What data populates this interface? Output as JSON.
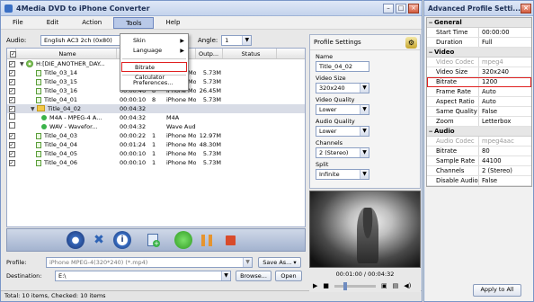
{
  "window": {
    "title": "4Media DVD to iPhone Converter"
  },
  "menubar": {
    "items": [
      "File",
      "Edit",
      "Action",
      "Tools",
      "Help"
    ]
  },
  "tools_menu": {
    "items": [
      {
        "label": "Skin",
        "submenu": true
      },
      {
        "label": "Language",
        "submenu": true
      },
      {
        "label": "Bitrate Calculator",
        "submenu": false
      },
      {
        "label": "Preferences...",
        "submenu": false
      }
    ]
  },
  "audio": {
    "label": "Audio:",
    "value": "English AC3 2ch (0x80)",
    "angle_label": "Angle:",
    "angle_value": "1"
  },
  "list": {
    "headers": [
      "Name",
      "Du",
      "",
      "Target",
      "Outp...",
      "Status"
    ],
    "rows": [
      {
        "kind": "disc",
        "checked": true,
        "name": "H:[DIE_ANOTHER_DAY...",
        "duration": "",
        "ch": "",
        "target": "",
        "output": "",
        "status": ""
      },
      {
        "kind": "title",
        "checked": true,
        "name": "Title_03_14",
        "duration": "00:00:10",
        "ch": "7",
        "target": "iPhone Mo...",
        "output": "5.73M",
        "status": ""
      },
      {
        "kind": "title",
        "checked": true,
        "name": "Title_03_15",
        "duration": "00:00:10",
        "ch": "7",
        "target": "iPhone Mo...",
        "output": "5.73M",
        "status": ""
      },
      {
        "kind": "title",
        "checked": true,
        "name": "Title_03_16",
        "duration": "00:00:46",
        "ch": "8",
        "target": "iPhone Mo...",
        "output": "26.45M",
        "status": ""
      },
      {
        "kind": "title",
        "checked": true,
        "name": "Title_04_01",
        "duration": "00:00:10",
        "ch": "8",
        "target": "iPhone Mo...",
        "output": "5.73M",
        "status": ""
      },
      {
        "kind": "folder",
        "checked": true,
        "name": "Title_04_02",
        "duration": "00:04:32",
        "ch": "",
        "target": "",
        "output": "",
        "status": ""
      },
      {
        "kind": "audio",
        "checked": false,
        "name": "M4A - MPEG-4 A...",
        "duration": "00:04:32",
        "ch": "",
        "target": "M4A",
        "output": "",
        "status": ""
      },
      {
        "kind": "audio",
        "checked": false,
        "name": "WAV - Wavefor...",
        "duration": "00:04:32",
        "ch": "",
        "target": "Wave Audio",
        "output": "",
        "status": ""
      },
      {
        "kind": "title",
        "checked": true,
        "name": "Title_04_03",
        "duration": "00:00:22",
        "ch": "1",
        "target": "iPhone Mo...",
        "output": "12.97M",
        "status": ""
      },
      {
        "kind": "title",
        "checked": true,
        "name": "Title_04_04",
        "duration": "00:01:24",
        "ch": "1",
        "target": "iPhone Mo...",
        "output": "48.30M",
        "status": ""
      },
      {
        "kind": "title",
        "checked": true,
        "name": "Title_04_05",
        "duration": "00:00:10",
        "ch": "1",
        "target": "iPhone Mo...",
        "output": "5.73M",
        "status": ""
      },
      {
        "kind": "title",
        "checked": true,
        "name": "Title_04_06",
        "duration": "00:00:10",
        "ch": "1",
        "target": "iPhone Mo...",
        "output": "5.73M",
        "status": ""
      }
    ]
  },
  "footer": {
    "profile_label": "Profile:",
    "profile_value": "iPhone MPEG-4(320*240)  (*.mp4)",
    "save_as": "Save As...",
    "destination_label": "Destination:",
    "destination_value": "E:\\",
    "browse": "Browse...",
    "open": "Open",
    "status": "Total: 10 items, Checked: 10 items"
  },
  "profile_settings": {
    "title": "Profile Settings",
    "fields": [
      {
        "label": "Name",
        "value": "Title_04_02",
        "type": "text"
      },
      {
        "label": "Video Size",
        "value": "320x240",
        "type": "select"
      },
      {
        "label": "Video Quality",
        "value": "Lower",
        "type": "select"
      },
      {
        "label": "Audio Quality",
        "value": "Lower",
        "type": "select"
      },
      {
        "label": "Channels",
        "value": "2 (Stereo)",
        "type": "select"
      },
      {
        "label": "Split",
        "value": "Infinite",
        "type": "select"
      }
    ]
  },
  "player": {
    "time": "00:01:00 / 00:04:32"
  },
  "advanced": {
    "title": "Advanced Profile Setti...",
    "apply": "Apply to All",
    "sections": [
      {
        "name": "General",
        "props": [
          {
            "k": "Start Time",
            "v": "00:00:00"
          },
          {
            "k": "Duration",
            "v": "Full"
          }
        ]
      },
      {
        "name": "Video",
        "props": [
          {
            "k": "Video Codec",
            "v": "mpeg4",
            "disabled": true
          },
          {
            "k": "Video Size",
            "v": "320x240"
          },
          {
            "k": "Bitrate",
            "v": "1200",
            "highlight": true
          },
          {
            "k": "Frame Rate",
            "v": "Auto"
          },
          {
            "k": "Aspect Ratio",
            "v": "Auto"
          },
          {
            "k": "Same Quality",
            "v": "False"
          },
          {
            "k": "Zoom",
            "v": "Letterbox"
          }
        ]
      },
      {
        "name": "Audio",
        "props": [
          {
            "k": "Audio Codec",
            "v": "mpeg4aac",
            "disabled": true
          },
          {
            "k": "Bitrate",
            "v": "80"
          },
          {
            "k": "Sample Rate",
            "v": "44100"
          },
          {
            "k": "Channels",
            "v": "2 (Stereo)"
          },
          {
            "k": "Disable Audio",
            "v": "False"
          }
        ]
      }
    ]
  },
  "colors": {
    "highlight_outline": "#e02020",
    "title_gradient_top": "#dfe8f7",
    "title_gradient_bottom": "#c4d3ec"
  }
}
